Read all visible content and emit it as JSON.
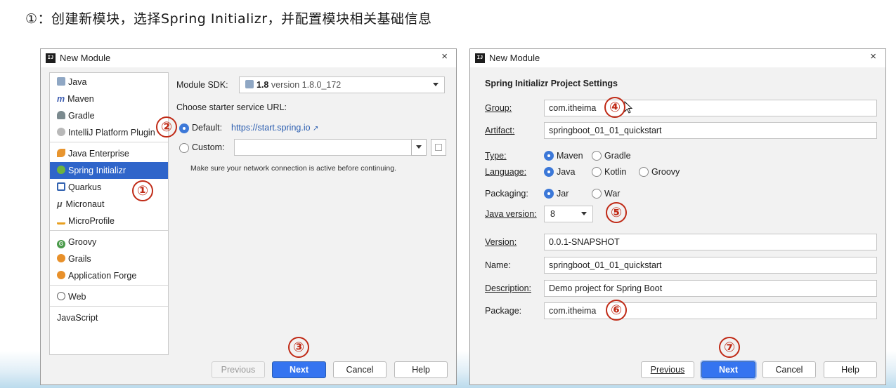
{
  "caption": "①：创建新模块，选择Spring Initializr，并配置模块相关基础信息",
  "left_dialog": {
    "title": "New Module",
    "close": "×",
    "modules": [
      {
        "label": "Java",
        "icon": "folder-icon"
      },
      {
        "label": "Maven",
        "icon": "maven-icon",
        "icon_text": "m"
      },
      {
        "label": "Gradle",
        "icon": "gradle-icon"
      },
      {
        "label": "IntelliJ Platform Plugin",
        "icon": "plugin-icon"
      },
      {
        "label": "Java Enterprise",
        "icon": "java-enterprise-icon"
      },
      {
        "label": "Spring Initializr",
        "icon": "spring-icon",
        "selected": true
      },
      {
        "label": "Quarkus",
        "icon": "quarkus-icon"
      },
      {
        "label": "Micronaut",
        "icon": "micronaut-icon",
        "icon_text": "μ"
      },
      {
        "label": "MicroProfile",
        "icon": "microprofile-icon"
      },
      {
        "label": "Groovy",
        "icon": "groovy-icon",
        "icon_text": "G"
      },
      {
        "label": "Grails",
        "icon": "grails-icon"
      },
      {
        "label": "Application Forge",
        "icon": "forge-icon"
      },
      {
        "label": "Web",
        "icon": "web-icon"
      },
      {
        "label": "JavaScript",
        "icon": ""
      }
    ],
    "sdk_label": "Module SDK:",
    "sdk_value_bold": "1.8",
    "sdk_value_rest": "version 1.8.0_172",
    "starter_label": "Choose starter service URL:",
    "default_label": "Default:",
    "default_url": "https://start.spring.io",
    "default_selected": true,
    "custom_label": "Custom:",
    "custom_value": "",
    "hint": "Make sure your network connection is active before continuing.",
    "buttons": {
      "previous": "Previous",
      "next": "Next",
      "cancel": "Cancel",
      "help": "Help"
    }
  },
  "right_dialog": {
    "title": "New Module",
    "close": "×",
    "heading": "Spring Initializr Project Settings",
    "fields": {
      "group_label": "Group:",
      "group_value": "com.itheima",
      "artifact_label": "Artifact:",
      "artifact_value": "springboot_01_01_quickstart",
      "type_label": "Type:",
      "type_options": [
        "Maven",
        "Gradle"
      ],
      "type_selected": "Maven",
      "language_label": "Language:",
      "language_options": [
        "Java",
        "Kotlin",
        "Groovy"
      ],
      "language_selected": "Java",
      "packaging_label": "Packaging:",
      "packaging_options": [
        "Jar",
        "War"
      ],
      "packaging_selected": "Jar",
      "java_version_label": "Java version:",
      "java_version_value": "8",
      "version_label": "Version:",
      "version_value": "0.0.1-SNAPSHOT",
      "name_label": "Name:",
      "name_value": "springboot_01_01_quickstart",
      "description_label": "Description:",
      "description_value": "Demo project for Spring Boot",
      "package_label": "Package:",
      "package_value": "com.itheima"
    },
    "buttons": {
      "previous": "Previous",
      "next": "Next",
      "cancel": "Cancel",
      "help": "Help"
    }
  },
  "callouts": [
    "①",
    "②",
    "③",
    "④",
    "⑤",
    "⑥",
    "⑦"
  ],
  "colors": {
    "accent": "#2f65ca",
    "callout": "#c02a16",
    "primary_button": "#3574f0"
  }
}
